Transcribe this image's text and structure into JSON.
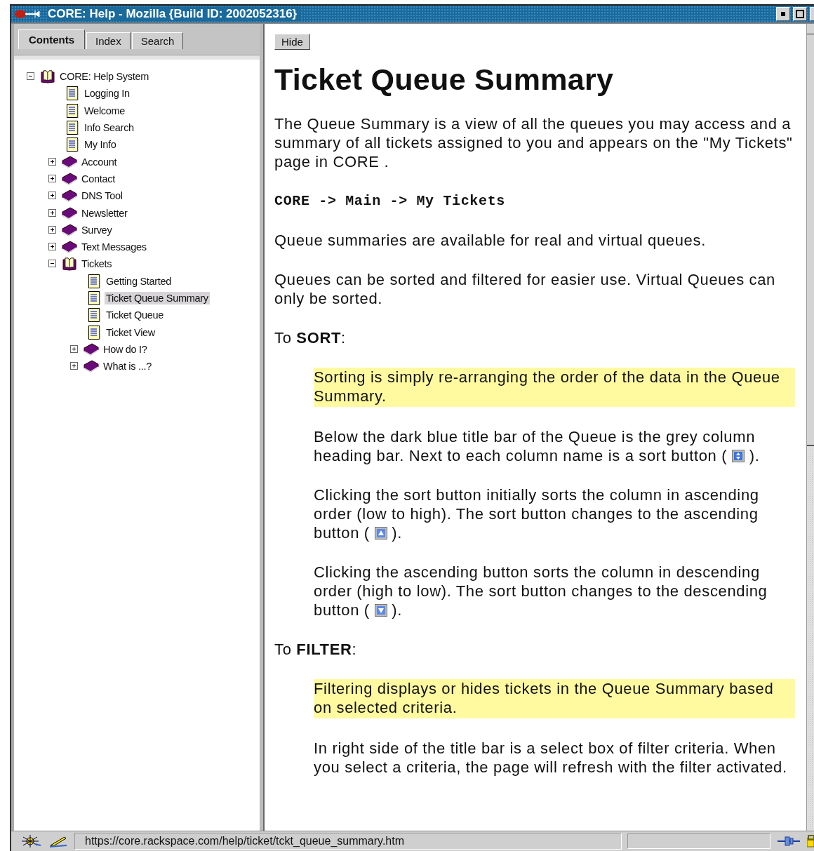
{
  "window": {
    "title": "CORE: Help - Mozilla {Build ID: 2002052316}"
  },
  "tabs": [
    {
      "label": "Contents",
      "selected": true
    },
    {
      "label": "Index",
      "selected": false
    },
    {
      "label": "Search",
      "selected": false
    }
  ],
  "tree": [
    {
      "label": "CORE: Help System",
      "kind": "book",
      "expanded": true,
      "selected": false,
      "children": [
        {
          "label": "Logging In",
          "kind": "page",
          "selected": false
        },
        {
          "label": "Welcome",
          "kind": "page",
          "selected": false
        },
        {
          "label": "Info Search",
          "kind": "page",
          "selected": false
        },
        {
          "label": "My Info",
          "kind": "page",
          "selected": false
        },
        {
          "label": "Account",
          "kind": "book",
          "expanded": false,
          "selected": false
        },
        {
          "label": "Contact",
          "kind": "book",
          "expanded": false,
          "selected": false
        },
        {
          "label": "DNS Tool",
          "kind": "book",
          "expanded": false,
          "selected": false
        },
        {
          "label": "Newsletter",
          "kind": "book",
          "expanded": false,
          "selected": false
        },
        {
          "label": "Survey",
          "kind": "book",
          "expanded": false,
          "selected": false
        },
        {
          "label": "Text Messages",
          "kind": "book",
          "expanded": false,
          "selected": false
        },
        {
          "label": "Tickets",
          "kind": "book",
          "expanded": true,
          "selected": false,
          "children": [
            {
              "label": "Getting Started",
              "kind": "page",
              "selected": false
            },
            {
              "label": "Ticket Queue Summary",
              "kind": "page",
              "selected": true
            },
            {
              "label": "Ticket Queue",
              "kind": "page",
              "selected": false
            },
            {
              "label": "Ticket View",
              "kind": "page",
              "selected": false
            },
            {
              "label": "How do I?",
              "kind": "book",
              "expanded": false,
              "selected": false
            },
            {
              "label": "What is ...?",
              "kind": "book",
              "expanded": false,
              "selected": false
            }
          ]
        }
      ]
    }
  ],
  "hide_button": "Hide",
  "content": {
    "title": "Ticket Queue Summary",
    "blocks": [
      {
        "kind": "para",
        "text": "The Queue Summary is a view of all the queues you may access and a summary of all tickets assigned to you and appears on the \"My Tickets\" page in CORE ."
      },
      {
        "kind": "path",
        "text": "CORE -> Main -> My Tickets"
      },
      {
        "kind": "para",
        "text": "Queue summaries are available for real and virtual queues."
      },
      {
        "kind": "para",
        "text": "Queues can be sorted and filtered for easier use. Virtual Queues can only be sorted."
      },
      {
        "kind": "para",
        "text": "To **SORT**:"
      },
      {
        "kind": "note",
        "text": "Sorting is simply re-arranging the order of the data in the Queue Summary."
      },
      {
        "kind": "sortpara",
        "text": "Below the dark blue title bar of the Queue is the grey column heading bar. Next to each column name is a sort button (",
        "after": ")."
      },
      {
        "kind": "ascpara",
        "text": "Clicking the sort button initially sorts the column in ascending order (low to high). The sort button changes to the ascending button (",
        "after": ")."
      },
      {
        "kind": "descpara",
        "text": "Clicking the ascending button sorts the column in descending order (high to low). The sort button changes to the descending button (",
        "after": ")."
      },
      {
        "kind": "para",
        "text": "To **FILTER**:"
      },
      {
        "kind": "note",
        "text": "Filtering displays or hides tickets in the Queue Summary based on selected criteria."
      },
      {
        "kind": "indent",
        "text": "In right side of the title bar is a select box of filter criteria. When you select a criteria, the page will refresh with the filter activated."
      }
    ]
  },
  "status_bar": {
    "url": "https://core.rackspace.com/help/ticket/tckt_queue_summary.htm"
  }
}
